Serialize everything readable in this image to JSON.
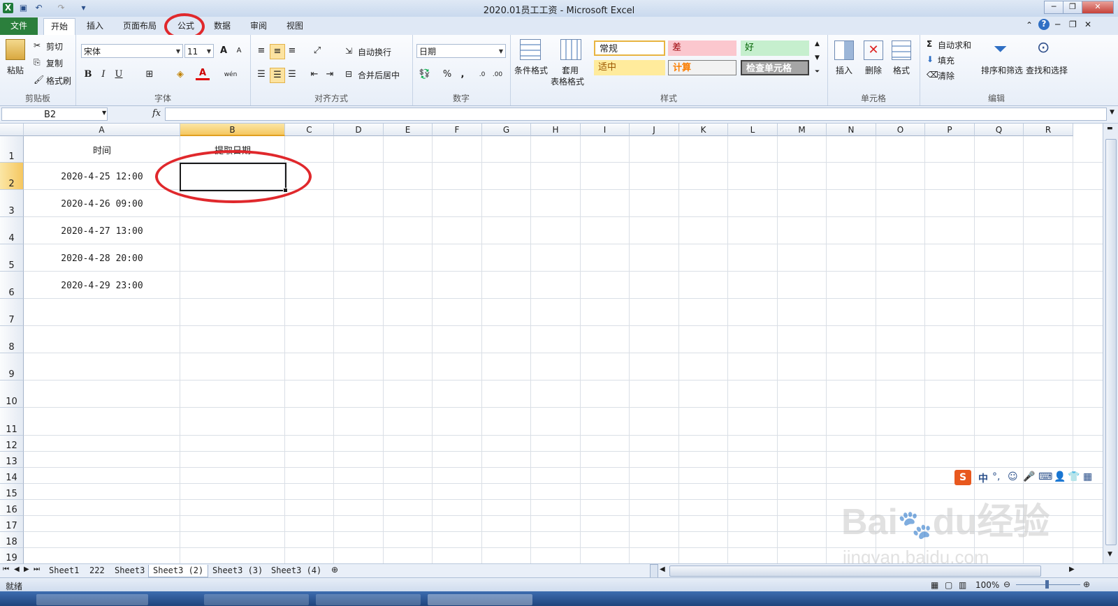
{
  "window": {
    "title": "2020.01员工工资 - Microsoft Excel"
  },
  "tabs": [
    {
      "label": "文件"
    },
    {
      "label": "开始"
    },
    {
      "label": "插入"
    },
    {
      "label": "页面布局"
    },
    {
      "label": "公式"
    },
    {
      "label": "数据"
    },
    {
      "label": "审阅"
    },
    {
      "label": "视图"
    }
  ],
  "ribbon": {
    "clipboard": {
      "paste": "粘贴",
      "cut": "剪切",
      "copy": "复制",
      "format_painter": "格式刷",
      "label": "剪贴板"
    },
    "font": {
      "name": "宋体",
      "size": "11",
      "label": "字体",
      "bold": "B",
      "italic": "I",
      "underline": "U",
      "grow": "A",
      "shrink": "A",
      "font_color": "A",
      "phonetic": "wén"
    },
    "alignment": {
      "wrap": "自动换行",
      "merge": "合并后居中",
      "label": "对齐方式"
    },
    "number": {
      "format": "日期",
      "percent": "%",
      "comma": ",",
      "label": "数字"
    },
    "styles": {
      "conditional": "条件格式",
      "table1": "套用",
      "table2": "表格格式",
      "label": "样式",
      "normal": "常规",
      "bad": "差",
      "good": "好",
      "neutral": "适中",
      "calc": "计算",
      "check": "检查单元格"
    },
    "cells": {
      "insert": "插入",
      "delete": "删除",
      "format": "格式",
      "label": "单元格"
    },
    "editing": {
      "autosum": "自动求和",
      "fill": "填充",
      "clear": "清除",
      "sort": "排序和筛选",
      "find": "查找和选择",
      "label": "编辑"
    }
  },
  "formula_bar": {
    "name_box": "B2",
    "fx": "fx",
    "value": ""
  },
  "grid": {
    "columns": [
      "A",
      "B",
      "C",
      "D",
      "E",
      "F",
      "G",
      "H",
      "I",
      "J",
      "K",
      "L",
      "M",
      "N",
      "O",
      "P",
      "Q",
      "R"
    ],
    "rows": [
      "1",
      "2",
      "3",
      "4",
      "5",
      "6",
      "7",
      "8",
      "9",
      "10",
      "11",
      "12",
      "13",
      "14",
      "15",
      "16",
      "17",
      "18",
      "19"
    ],
    "cells": {
      "A1": "时间",
      "B1": "提取日期",
      "A2": "2020-4-25 12:00",
      "A3": "2020-4-26 09:00",
      "A4": "2020-4-27 13:00",
      "A5": "2020-4-28 20:00",
      "A6": "2020-4-29 23:00"
    },
    "selected_cell": "B2"
  },
  "sheets": [
    {
      "name": "Sheet1"
    },
    {
      "name": "222"
    },
    {
      "name": "Sheet3"
    },
    {
      "name": "Sheet3 (2)"
    },
    {
      "name": "Sheet3 (3)"
    },
    {
      "name": "Sheet3 (4)"
    }
  ],
  "active_sheet": "Sheet3 (2)",
  "status": {
    "ready": "就绪",
    "zoom": "100%"
  },
  "ime": {
    "lang": "中",
    "punct": "°,"
  },
  "watermark": {
    "brand": "Bai",
    "brand2": "du",
    "cn": "经验",
    "url": "jingyan.baidu.com"
  },
  "colors": {
    "accent": "#2b7f3c",
    "annotation": "#e0282c",
    "selection": "#f5c760"
  }
}
